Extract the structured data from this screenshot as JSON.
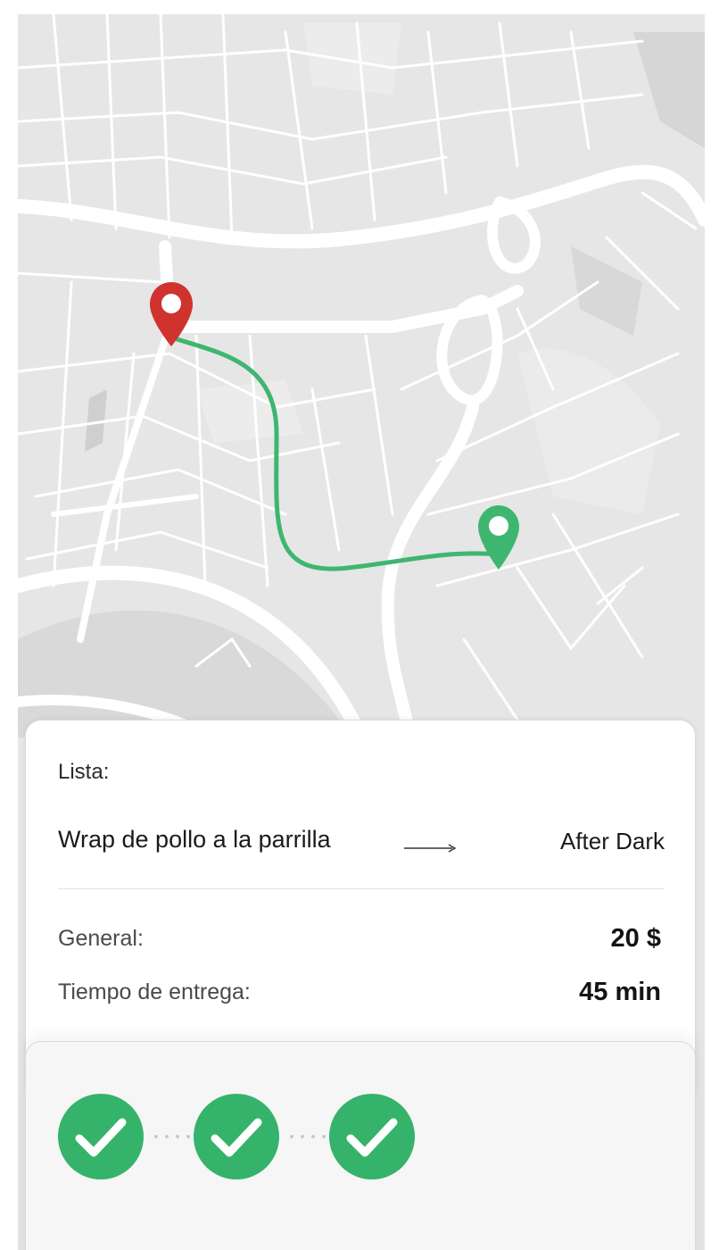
{
  "map": {
    "colors": {
      "background": "#e6e6e6",
      "road": "#ffffff",
      "route": "#3fb66f",
      "origin_pin": "#d0332e",
      "destination_pin": "#3fb66f"
    }
  },
  "order": {
    "list_label": "Lista:",
    "item_name": "Wrap de pollo a la parrilla",
    "arrow_icon": "arrow-right-icon",
    "restaurant": "After Dark",
    "total_label": "General:",
    "total_value": "20 $",
    "delivery_label": "Tiempo de entrega:",
    "delivery_value": "45 min"
  },
  "status": {
    "steps_completed": 3,
    "steps": [
      {
        "icon": "check-icon",
        "state": "completed"
      },
      {
        "icon": "check-icon",
        "state": "completed"
      },
      {
        "icon": "check-icon",
        "state": "completed"
      }
    ],
    "accent_color": "#35b36a"
  }
}
